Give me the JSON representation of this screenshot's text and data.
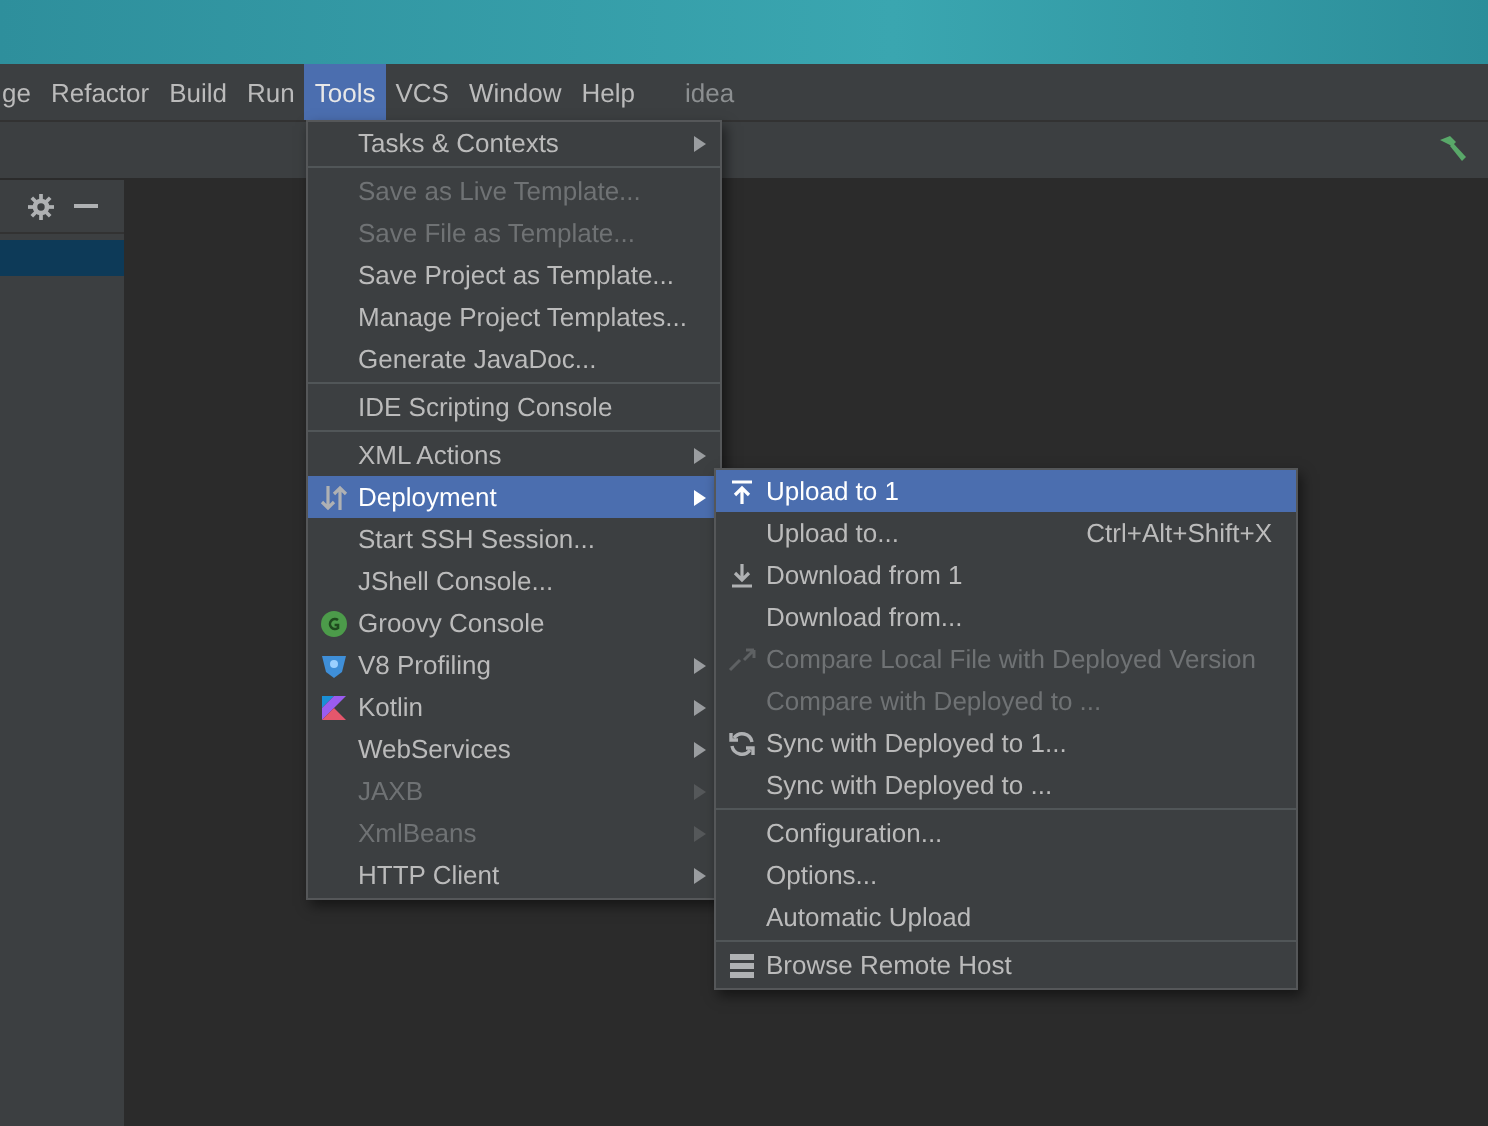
{
  "menubar": [
    {
      "label": "ge",
      "selected": false
    },
    {
      "label": "Refactor",
      "selected": false
    },
    {
      "label": "Build",
      "selected": false
    },
    {
      "label": "Run",
      "selected": false
    },
    {
      "label": "Tools",
      "selected": true
    },
    {
      "label": "VCS",
      "selected": false
    },
    {
      "label": "Window",
      "selected": false
    },
    {
      "label": "Help",
      "selected": false
    }
  ],
  "project_title": "idea",
  "tools_menu": [
    {
      "kind": "item",
      "label": "Tasks & Contexts",
      "disabled": false,
      "selected": false,
      "submenu": true
    },
    {
      "kind": "separator"
    },
    {
      "kind": "item",
      "label": "Save as Live Template...",
      "disabled": true,
      "selected": false,
      "submenu": false
    },
    {
      "kind": "item",
      "label": "Save File as Template...",
      "disabled": true,
      "selected": false,
      "submenu": false
    },
    {
      "kind": "item",
      "label": "Save Project as Template...",
      "disabled": false,
      "selected": false,
      "submenu": false
    },
    {
      "kind": "item",
      "label": "Manage Project Templates...",
      "disabled": false,
      "selected": false,
      "submenu": false
    },
    {
      "kind": "item",
      "label": "Generate JavaDoc...",
      "disabled": false,
      "selected": false,
      "submenu": false
    },
    {
      "kind": "separator"
    },
    {
      "kind": "item",
      "label": "IDE Scripting Console",
      "disabled": false,
      "selected": false,
      "submenu": false
    },
    {
      "kind": "separator"
    },
    {
      "kind": "item",
      "label": "XML Actions",
      "disabled": false,
      "selected": false,
      "submenu": true
    },
    {
      "kind": "item",
      "label": "Deployment",
      "disabled": false,
      "selected": true,
      "submenu": true
    },
    {
      "kind": "item",
      "label": "Start SSH Session...",
      "disabled": false,
      "selected": false,
      "submenu": false
    },
    {
      "kind": "item",
      "label": "JShell Console...",
      "disabled": false,
      "selected": false,
      "submenu": false
    },
    {
      "kind": "item",
      "label": "Groovy Console",
      "disabled": false,
      "selected": false,
      "submenu": false
    },
    {
      "kind": "item",
      "label": "V8 Profiling",
      "disabled": false,
      "selected": false,
      "submenu": true
    },
    {
      "kind": "item",
      "label": "Kotlin",
      "disabled": false,
      "selected": false,
      "submenu": true
    },
    {
      "kind": "item",
      "label": "WebServices",
      "disabled": false,
      "selected": false,
      "submenu": true
    },
    {
      "kind": "item",
      "label": "JAXB",
      "disabled": true,
      "selected": false,
      "submenu": true
    },
    {
      "kind": "item",
      "label": "XmlBeans",
      "disabled": true,
      "selected": false,
      "submenu": true
    },
    {
      "kind": "item",
      "label": "HTTP Client",
      "disabled": false,
      "selected": false,
      "submenu": true
    }
  ],
  "deployment_menu": [
    {
      "kind": "item",
      "label": "Upload to 1",
      "disabled": false,
      "selected": true,
      "submenu": false
    },
    {
      "kind": "item",
      "label": "Upload to...",
      "disabled": false,
      "selected": false,
      "submenu": false,
      "shortcut": "Ctrl+Alt+Shift+X"
    },
    {
      "kind": "item",
      "label": "Download from 1",
      "disabled": false,
      "selected": false,
      "submenu": false
    },
    {
      "kind": "item",
      "label": "Download from...",
      "disabled": false,
      "selected": false,
      "submenu": false
    },
    {
      "kind": "item",
      "label": "Compare Local File with Deployed Version",
      "disabled": true,
      "selected": false,
      "submenu": false
    },
    {
      "kind": "item",
      "label": "Compare with Deployed to ...",
      "disabled": true,
      "selected": false,
      "submenu": false
    },
    {
      "kind": "item",
      "label": "Sync with Deployed to 1...",
      "disabled": false,
      "selected": false,
      "submenu": false
    },
    {
      "kind": "item",
      "label": "Sync with Deployed to ...",
      "disabled": false,
      "selected": false,
      "submenu": false
    },
    {
      "kind": "separator"
    },
    {
      "kind": "item",
      "label": "Configuration...",
      "disabled": false,
      "selected": false,
      "submenu": false
    },
    {
      "kind": "item",
      "label": "Options...",
      "disabled": false,
      "selected": false,
      "submenu": false
    },
    {
      "kind": "item",
      "label": "Automatic Upload",
      "disabled": false,
      "selected": false,
      "submenu": false
    },
    {
      "kind": "separator"
    },
    {
      "kind": "item",
      "label": "Browse Remote Host",
      "disabled": false,
      "selected": false,
      "submenu": false
    }
  ]
}
